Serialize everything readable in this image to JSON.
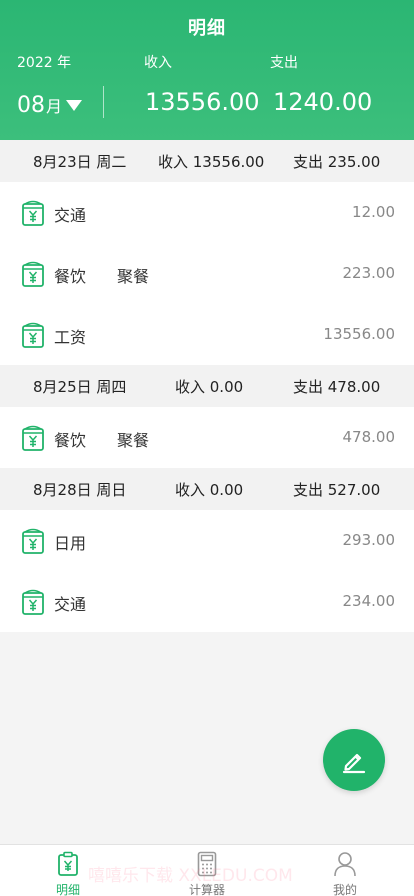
{
  "header": {
    "title": "明细",
    "year_label": "2022 年",
    "income_label": "收入",
    "expense_label": "支出",
    "month": "08",
    "month_unit": "月",
    "income_total": "13556.00",
    "expense_total": "1240.00"
  },
  "days": [
    {
      "date": "8月23日 周二",
      "income": "收入 13556.00",
      "expense": "支出 235.00",
      "rows": [
        {
          "category": "交通",
          "note": "",
          "amount": "12.00"
        },
        {
          "category": "餐饮",
          "note": "聚餐",
          "amount": "223.00"
        },
        {
          "category": "工资",
          "note": "",
          "amount": "13556.00"
        }
      ]
    },
    {
      "date": "8月25日 周四",
      "income": "收入 0.00",
      "expense": "支出 478.00",
      "rows": [
        {
          "category": "餐饮",
          "note": "聚餐",
          "amount": "478.00"
        }
      ]
    },
    {
      "date": "8月28日 周日",
      "income": "收入 0.00",
      "expense": "支出 527.00",
      "rows": [
        {
          "category": "日用",
          "note": "",
          "amount": "293.00"
        },
        {
          "category": "交通",
          "note": "",
          "amount": "234.00"
        }
      ]
    }
  ],
  "tabs": [
    {
      "label": "明细",
      "icon": "ledger-icon",
      "active": true
    },
    {
      "label": "计算器",
      "icon": "calculator-icon",
      "active": false
    },
    {
      "label": "我的",
      "icon": "user-icon",
      "active": false
    }
  ],
  "watermark": "嘻嘻乐下载 XXLEDU.COM",
  "colors": {
    "brand": "#2bb673",
    "fab": "#21b36a",
    "icon": "#21b36a"
  },
  "fab_icon": "edit-pencil-icon"
}
